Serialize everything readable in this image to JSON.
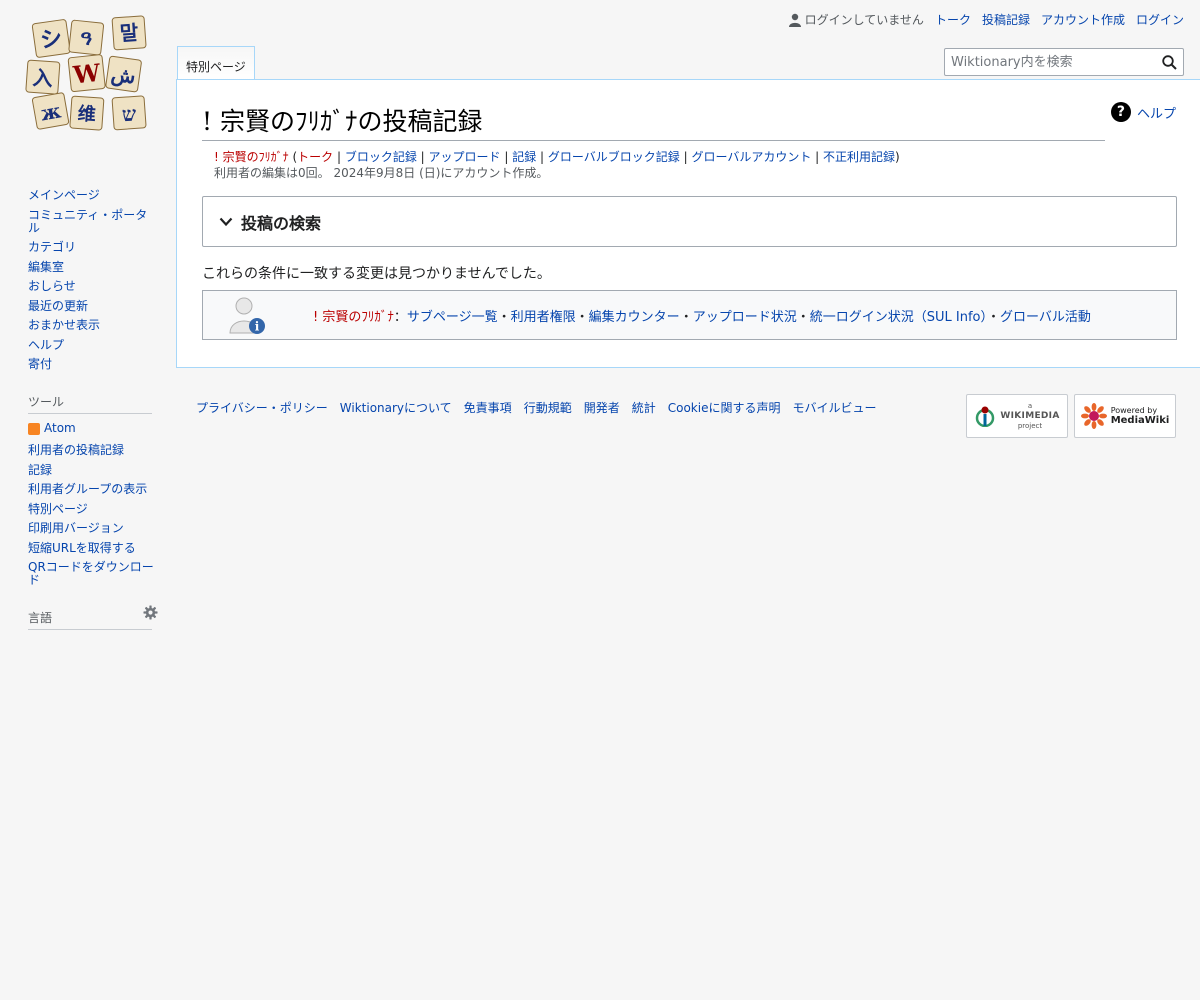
{
  "personal": {
    "anon": "ログインしていません",
    "talk": "トーク",
    "contribs": "投稿記録",
    "create": "アカウント作成",
    "login": "ログイン"
  },
  "tabs": {
    "special": "特別ページ"
  },
  "search": {
    "placeholder": "Wiktionary内を検索"
  },
  "page": {
    "title": "! 宗賢のﾌﾘｶﾞﾅの投稿記録",
    "help": "ヘルプ",
    "user": "! 宗賢のﾌﾘｶﾞﾅ",
    "links": [
      "トーク",
      "ブロック記録",
      "アップロード",
      "記録",
      "グローバルブロック記録",
      "グローバルアカウント",
      "不正利用記録"
    ],
    "info": "利用者の編集は0回。 2024年9月8日 (日)にアカウント作成。",
    "search_section": "投稿の検索",
    "no_results": "これらの条件に一致する変更は見つかりませんでした。",
    "userbox_user": "! 宗賢のﾌﾘｶﾞﾅ",
    "userbox_links": [
      "サブページ一覧",
      "利用者権限",
      "編集カウンター",
      "アップロード状況",
      "統一ログイン状況（SUL Info）",
      "グローバル活動"
    ]
  },
  "sidebar": {
    "nav": [
      "メインページ",
      "コミュニティ・ポータル",
      "カテゴリ",
      "編集室",
      "おしらせ",
      "最近の更新",
      "おまかせ表示",
      "ヘルプ",
      "寄付"
    ],
    "tools_heading": "ツール",
    "tools": [
      "Atom",
      "利用者の投稿記録",
      "記録",
      "利用者グループの表示",
      "特別ページ",
      "印刷用バージョン",
      "短縮URLを取得する",
      "QRコードをダウンロード"
    ],
    "langs_heading": "言語"
  },
  "footer": {
    "links": [
      "プライバシー・ポリシー",
      "Wiktionaryについて",
      "免責事項",
      "行動規範",
      "開発者",
      "統計",
      "Cookieに関する声明",
      "モバイルビュー"
    ],
    "wikimedia_small": "a",
    "wikimedia_big": "WIKIMEDIA",
    "wikimedia_sub": "project",
    "mediawiki_top": "Powered by",
    "mediawiki_big": "MediaWiki"
  },
  "logo_tiles": [
    "シ",
    "ዓ",
    "말",
    "入",
    "W",
    "ش",
    "ж",
    "维",
    "ש"
  ],
  "colors": {
    "link": "#0645ad",
    "redlink": "#ba0000",
    "border": "#a7d7f9",
    "feed": "#f78422"
  }
}
